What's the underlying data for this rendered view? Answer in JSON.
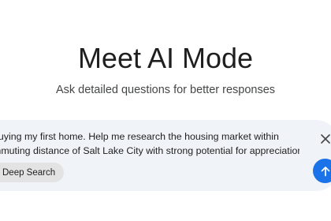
{
  "hero": {
    "title": "Meet AI Mode",
    "subtitle": "Ask detailed questions for better responses"
  },
  "composer": {
    "query_lines": [
      "buying my first home. Help me research the housing market within",
      "mmuting distance of Salt Lake City with strong potential for appreciation."
    ],
    "chip_label": "Deep Search",
    "close_icon": "close-icon",
    "send_icon": "arrow-up-icon"
  },
  "colors": {
    "accent": "#1a73e8",
    "composer_bg": "#f0f4f9",
    "chip_bg": "#e3e3e3",
    "text_primary": "#1f1f1f",
    "text_secondary": "#444746"
  }
}
